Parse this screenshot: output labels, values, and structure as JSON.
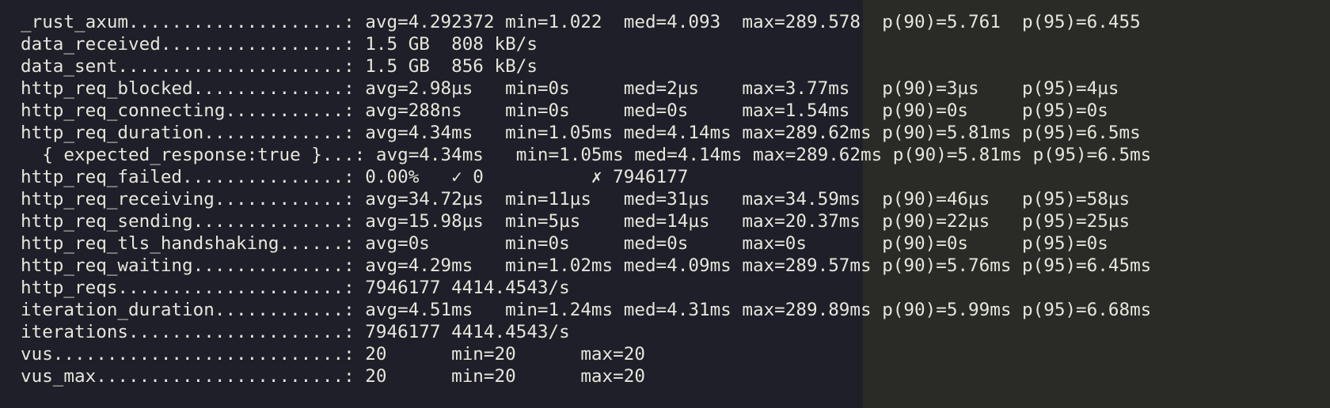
{
  "terminal": {
    "lines": [
      "_rust_axum....................: avg=4.292372 min=1.022  med=4.093  max=289.578  p(90)=5.761  p(95)=6.455",
      "data_received.................: 1.5 GB  808 kB/s",
      "data_sent.....................: 1.5 GB  856 kB/s",
      "http_req_blocked..............: avg=2.98µs   min=0s     med=2µs    max=3.77ms   p(90)=3µs    p(95)=4µs",
      "http_req_connecting...........: avg=288ns    min=0s     med=0s     max=1.54ms   p(90)=0s     p(95)=0s",
      "http_req_duration.............: avg=4.34ms   min=1.05ms med=4.14ms max=289.62ms p(90)=5.81ms p(95)=6.5ms",
      "  { expected_response:true }...: avg=4.34ms   min=1.05ms med=4.14ms max=289.62ms p(90)=5.81ms p(95)=6.5ms",
      "http_req_failed...............: 0.00%   ✓ 0          ✗ 7946177",
      "http_req_receiving............: avg=34.72µs  min=11µs   med=31µs   max=34.59ms  p(90)=46µs   p(95)=58µs",
      "http_req_sending..............: avg=15.98µs  min=5µs    med=14µs   max=20.37ms  p(90)=22µs   p(95)=25µs",
      "http_req_tls_handshaking......: avg=0s       min=0s     med=0s     max=0s       p(90)=0s     p(95)=0s",
      "http_req_waiting..............: avg=4.29ms   min=1.02ms med=4.09ms max=289.57ms p(90)=5.76ms p(95)=6.45ms",
      "http_reqs.....................: 7946177 4414.4543/s",
      "iteration_duration............: avg=4.51ms   min=1.24ms med=4.31ms max=289.89ms p(90)=5.99ms p(95)=6.68ms",
      "iterations....................: 7946177 4414.4543/s",
      "vus...........................: 20      min=20      max=20",
      "vus_max.......................: 20      min=20      max=20"
    ]
  }
}
